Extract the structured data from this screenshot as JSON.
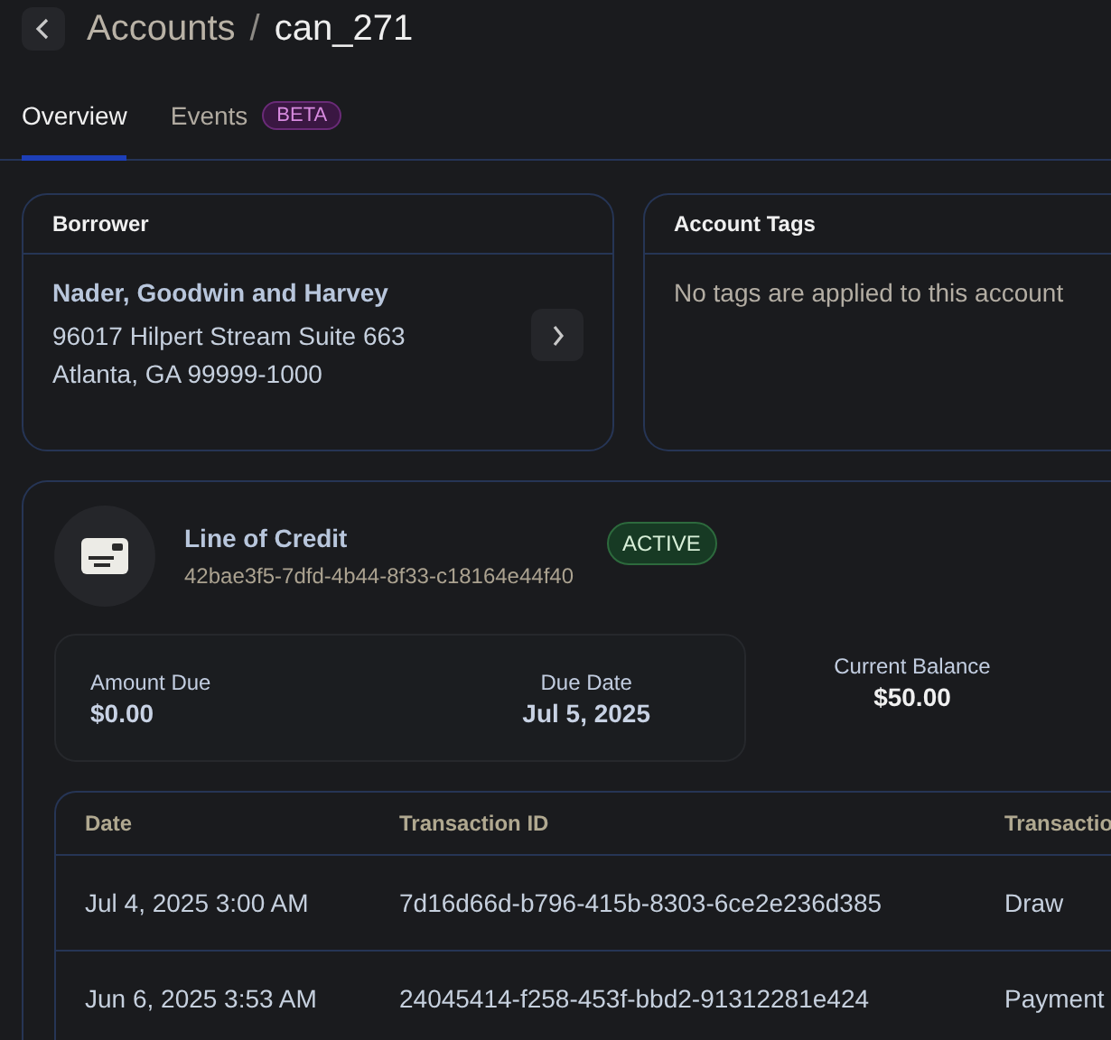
{
  "breadcrumb": {
    "parent": "Accounts",
    "separator": "/",
    "current": "can_271"
  },
  "tabs": [
    {
      "label": "Overview",
      "selected": true
    },
    {
      "label": "Events",
      "selected": false,
      "badge": "BETA"
    }
  ],
  "borrower": {
    "title": "Borrower",
    "name": "Nader, Goodwin and Harvey",
    "address_lines": [
      "96017 Hilpert Stream Suite 663",
      "Atlanta, GA 99999-1000"
    ]
  },
  "account_tags": {
    "title": "Account Tags",
    "empty_text": "No tags are applied to this account"
  },
  "credit": {
    "title": "Line of Credit",
    "id": "42bae3f5-7dfd-4b44-8f33-c18164e44f40",
    "status": "ACTIVE",
    "amount_due": {
      "label": "Amount Due",
      "value": "$0.00"
    },
    "due_date": {
      "label": "Due Date",
      "value": "Jul 5, 2025"
    },
    "current_balance": {
      "label": "Current Balance",
      "value": "$50.00"
    }
  },
  "transactions": {
    "columns": [
      "Date",
      "Transaction ID",
      "Transactio"
    ],
    "rows": [
      [
        "Jul 4, 2025 3:00 AM",
        "7d16d66d-b796-415b-8303-6ce2e236d385",
        "Draw"
      ],
      [
        "Jun 6, 2025 3:53 AM",
        "24045414-f258-453f-bbd2-91312281e424",
        "Payment"
      ]
    ]
  }
}
